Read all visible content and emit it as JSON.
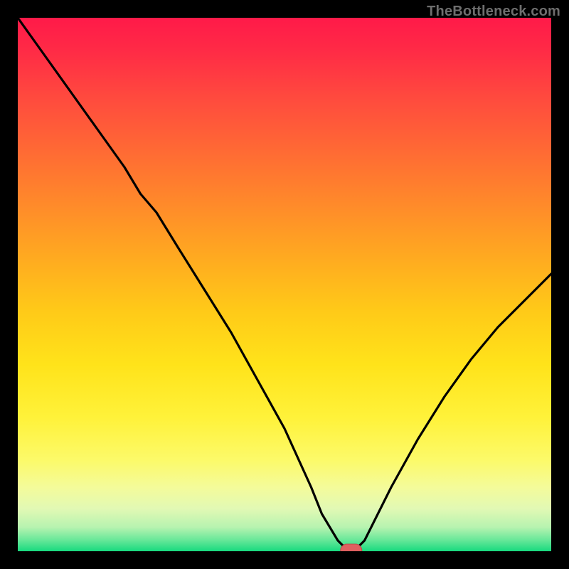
{
  "watermark": "TheBottleneck.com",
  "chart_data": {
    "type": "line",
    "title": "",
    "xlabel": "",
    "ylabel": "",
    "xlim": [
      0,
      100
    ],
    "ylim": [
      0,
      100
    ],
    "grid": false,
    "legend": false,
    "series": [
      {
        "name": "bottleneck-curve",
        "x": [
          0,
          5,
          10,
          15,
          20,
          23,
          26,
          30,
          35,
          40,
          45,
          50,
          55,
          57,
          60,
          62,
          63,
          65,
          67,
          70,
          75,
          80,
          85,
          90,
          95,
          100
        ],
        "values": [
          100,
          93,
          86,
          79,
          72,
          67,
          63.5,
          57,
          49,
          41,
          32,
          23,
          12,
          7,
          2,
          0,
          0,
          2,
          6,
          12,
          21,
          29,
          36,
          42,
          47,
          52
        ]
      }
    ],
    "marker": {
      "x": 62.5,
      "y": 0
    },
    "background": "red-yellow-green-vertical-gradient"
  }
}
